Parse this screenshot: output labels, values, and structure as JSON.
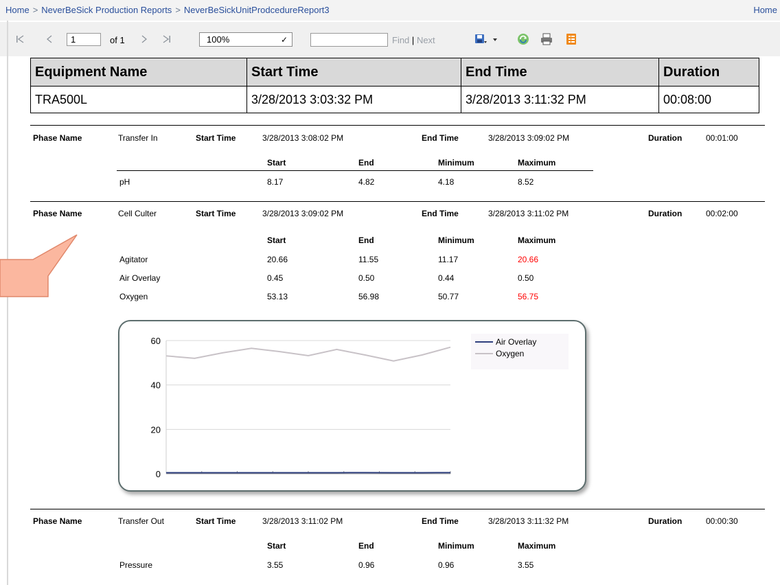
{
  "breadcrumb": {
    "items": [
      "Home",
      "NeverBeSick Production Reports",
      "NeverBeSickUnitProdcedureReport3"
    ],
    "separator": ">",
    "right_link": "Home"
  },
  "toolbar": {
    "page_value": "1",
    "page_of": "of 1",
    "zoom": "100%",
    "find_value": "",
    "find_label": "Find",
    "find_sep": "|",
    "next_label": "Next"
  },
  "equipment": {
    "headers": [
      "Equipment Name",
      "Start Time",
      "End Time",
      "Duration"
    ],
    "row": [
      "TRA500L",
      "3/28/2013 3:03:32 PM",
      "3/28/2013 3:11:32 PM",
      "00:08:00"
    ]
  },
  "labels": {
    "phase_name": "Phase Name",
    "start_time": "Start Time",
    "end_time": "End Time",
    "duration": "Duration",
    "col_start": "Start",
    "col_end": "End",
    "col_min": "Minimum",
    "col_max": "Maximum"
  },
  "phases": [
    {
      "name": "Transfer In",
      "start_time": "3/28/2013 3:08:02 PM",
      "end_time": "3/28/2013 3:09:02 PM",
      "duration": "00:01:00",
      "params": [
        {
          "name": "pH",
          "start": "8.17",
          "end": "4.82",
          "min": "4.18",
          "max": "8.52",
          "max_alert": false
        }
      ]
    },
    {
      "name": "Cell Culter",
      "start_time": "3/28/2013 3:09:02 PM",
      "end_time": "3/28/2013 3:11:02 PM",
      "duration": "00:02:00",
      "params": [
        {
          "name": "Agitator",
          "start": "20.66",
          "end": "11.55",
          "min": "11.17",
          "max": "20.66",
          "max_alert": true
        },
        {
          "name": "Air Overlay",
          "start": "0.45",
          "end": "0.50",
          "min": "0.44",
          "max": "0.50",
          "max_alert": false
        },
        {
          "name": "Oxygen",
          "start": "53.13",
          "end": "56.98",
          "min": "50.77",
          "max": "56.75",
          "max_alert": true
        }
      ]
    },
    {
      "name": "Transfer Out",
      "start_time": "3/28/2013 3:11:02 PM",
      "end_time": "3/28/2013 3:11:32 PM",
      "duration": "00:00:30",
      "params": [
        {
          "name": "Pressure",
          "start": "3.55",
          "end": "0.96",
          "min": "0.96",
          "max": "3.55",
          "max_alert": false
        }
      ]
    }
  ],
  "chart_data": {
    "type": "line",
    "title": "",
    "xlabel": "",
    "ylabel": "",
    "ylim": [
      0,
      60
    ],
    "yticks": [
      "0",
      "20",
      "40",
      "60"
    ],
    "x": [
      0,
      1,
      2,
      3,
      4,
      5,
      6,
      7,
      8,
      9,
      10
    ],
    "series": [
      {
        "name": "Air Overlay",
        "color": "#2e3f7d",
        "values": [
          0.45,
          0.46,
          0.47,
          0.48,
          0.47,
          0.46,
          0.48,
          0.49,
          0.47,
          0.48,
          0.5
        ]
      },
      {
        "name": "Oxygen",
        "color": "#c8c2c7",
        "values": [
          53.1,
          52.0,
          54.5,
          56.5,
          55.0,
          53.2,
          56.0,
          53.5,
          50.8,
          53.5,
          57.0
        ]
      }
    ],
    "legend": "top-right",
    "grid": true
  },
  "colors": {
    "alert": "#ff0000",
    "link": "#2a4f9b",
    "header_bg": "#d9d9d9",
    "callout": "#fbb79f"
  }
}
